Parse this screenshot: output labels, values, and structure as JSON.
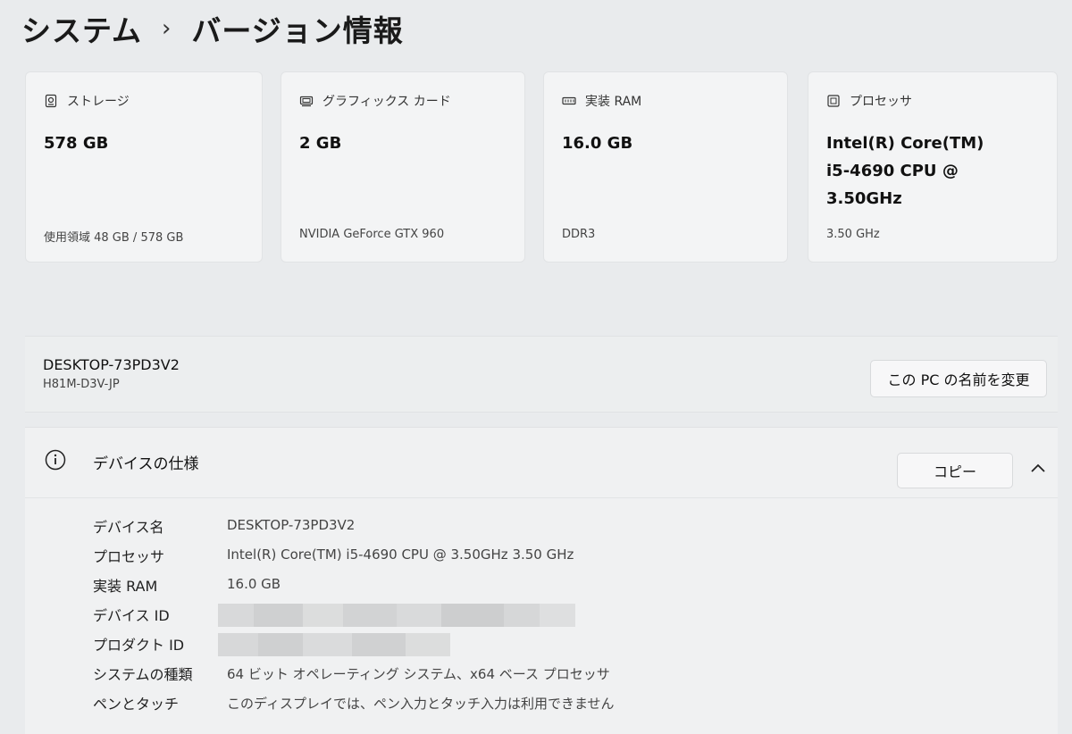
{
  "breadcrumb": {
    "parent": "システム",
    "separator": "›",
    "current": "バージョン情報"
  },
  "cards": [
    {
      "icon": "storage-icon",
      "label": "ストレージ",
      "value": "578 GB",
      "sub": "使用領域 48 GB / 578 GB"
    },
    {
      "icon": "graphics-card-icon",
      "label": "グラフィックス カード",
      "value": "2 GB",
      "sub": "NVIDIA GeForce GTX 960"
    },
    {
      "icon": "ram-icon",
      "label": "実装 RAM",
      "value": "16.0 GB",
      "sub": "DDR3"
    },
    {
      "icon": "processor-icon",
      "label": "プロセッサ",
      "value": "Intel(R) Core(TM) i5-4690 CPU @ 3.50GHz",
      "sub": "3.50 GHz"
    }
  ],
  "device": {
    "name": "DESKTOP-73PD3V2",
    "model": "H81M-D3V-JP",
    "rename_label": "この PC の名前を変更"
  },
  "specs": {
    "title": "デバイスの仕様",
    "copy_label": "コピー",
    "rows": [
      {
        "label": "デバイス名",
        "value": "DESKTOP-73PD3V2"
      },
      {
        "label": "プロセッサ",
        "value": "Intel(R) Core(TM) i5-4690 CPU @ 3.50GHz   3.50 GHz"
      },
      {
        "label": "実装 RAM",
        "value": "16.0 GB"
      },
      {
        "label": "デバイス ID",
        "value": ""
      },
      {
        "label": "プロダクト ID",
        "value": ""
      },
      {
        "label": "システムの種類",
        "value": "64 ビット オペレーティング システム、x64 ベース プロセッサ"
      },
      {
        "label": "ペンとタッチ",
        "value": "このディスプレイでは、ペン入力とタッチ入力は利用できません"
      }
    ]
  },
  "colors": {
    "background": "#e9ebed",
    "card": "#f3f4f5",
    "text": "#1b1b1b"
  }
}
